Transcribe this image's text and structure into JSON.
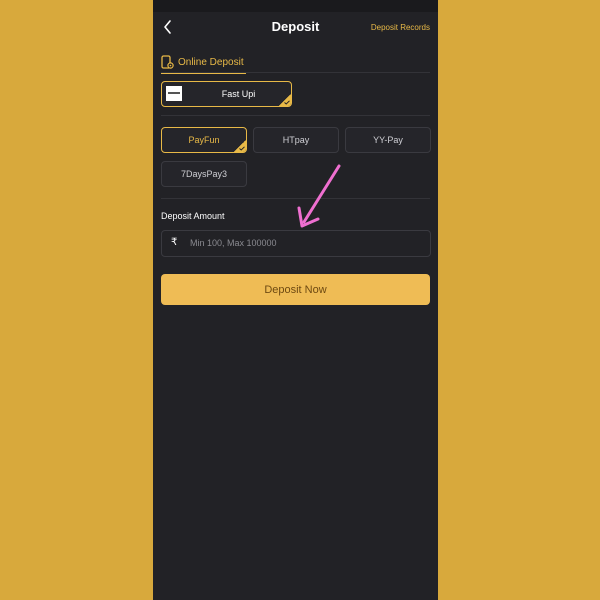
{
  "header": {
    "title": "Deposit",
    "records_label": "Deposit Records"
  },
  "section_tab": {
    "label": "Online Deposit"
  },
  "channel": {
    "label": "Fast Upi",
    "selected": true
  },
  "pay_options": [
    {
      "label": "PayFun",
      "selected": true
    },
    {
      "label": "HTpay",
      "selected": false
    },
    {
      "label": "YY-Pay",
      "selected": false
    },
    {
      "label": "7DaysPay3",
      "selected": false
    }
  ],
  "amount": {
    "label": "Deposit Amount",
    "currency_symbol": "₹",
    "value": "",
    "placeholder": "Min 100, Max 100000"
  },
  "submit": {
    "label": "Deposit Now"
  },
  "colors": {
    "background": "#d8a93c",
    "panel": "#222226",
    "accent": "#e8b947",
    "button": "#efbc55",
    "annotation_arrow": "#ef6fd0"
  },
  "icons": {
    "back": "chevron-left-icon",
    "section": "mobile-wallet-icon",
    "check": "check-corner-icon",
    "currency": "rupee-icon",
    "annotation": "pink-arrow-icon"
  }
}
